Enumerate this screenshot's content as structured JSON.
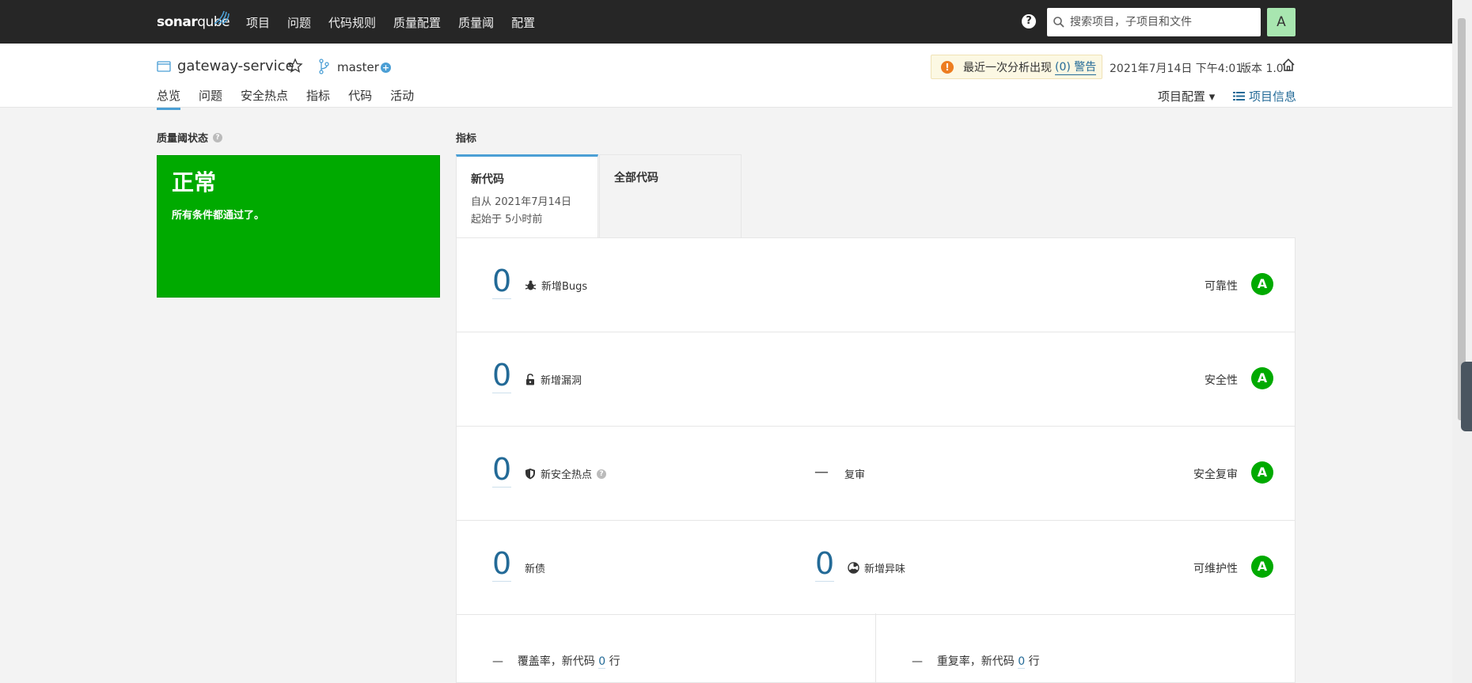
{
  "topbar": {
    "logo_bold": "sonar",
    "logo_light": "qube",
    "nav": [
      "项目",
      "问题",
      "代码规则",
      "质量配置",
      "质量阈",
      "配置"
    ],
    "help": "?",
    "search_placeholder": "搜索项目，子项目和文件",
    "avatar": "A"
  },
  "project": {
    "name": "gateway-service",
    "branch": "master",
    "warning_text": "最近一次分析出现",
    "warning_link": "(0) 警告",
    "analysis_date": "2021年7月14日 下午4:01",
    "version": "版本 1.0",
    "subnav": [
      "总览",
      "问题",
      "安全热点",
      "指标",
      "代码",
      "活动"
    ],
    "config": "项目配置 ▾",
    "info": "项目信息"
  },
  "quality_gate": {
    "title": "质量阈状态",
    "status": "正常",
    "description": "所有条件都通过了。"
  },
  "metrics": {
    "title": "指标",
    "tab_new": {
      "label": "新代码",
      "line1": "自从 2021年7月14日",
      "line2": "起始于 5小时前"
    },
    "tab_all": {
      "label": "全部代码"
    },
    "rows": {
      "bugs": {
        "value": "0",
        "label": "新增Bugs",
        "rating_label": "可靠性",
        "rating": "A"
      },
      "vulns": {
        "value": "0",
        "label": "新增漏洞",
        "rating_label": "安全性",
        "rating": "A"
      },
      "hotspots": {
        "value": "0",
        "label": "新安全热点",
        "dash": "—",
        "review": "复审",
        "rating_label": "安全复审",
        "rating": "A"
      },
      "debt": {
        "value": "0",
        "label": "新债",
        "smell_value": "0",
        "smell_label": "新增异味",
        "rating_label": "可维护性",
        "rating": "A"
      }
    },
    "coverage": {
      "dash": "—",
      "text": "覆盖率，新代码",
      "num": "0",
      "unit": "行"
    },
    "duplication": {
      "dash": "—",
      "text": "重复率，新代码",
      "num": "0",
      "unit": "行"
    }
  }
}
